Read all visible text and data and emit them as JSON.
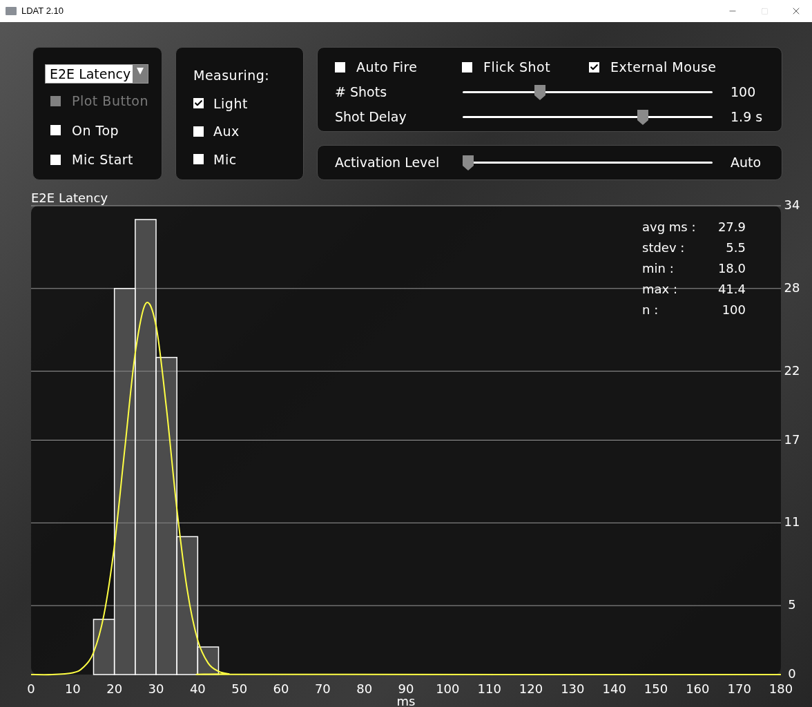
{
  "window": {
    "title": "LDAT 2.10",
    "maximize_disabled": true
  },
  "mode_panel": {
    "dropdown": {
      "value": "E2E Latency"
    },
    "options": [
      {
        "label": "Plot Button",
        "checked": false,
        "disabled": true
      },
      {
        "label": "On Top",
        "checked": false,
        "disabled": false
      },
      {
        "label": "Mic Start",
        "checked": false,
        "disabled": false
      }
    ]
  },
  "measuring_panel": {
    "title": "Measuring:",
    "options": [
      {
        "label": "Light",
        "checked": true
      },
      {
        "label": "Aux",
        "checked": false
      },
      {
        "label": "Mic",
        "checked": false
      }
    ]
  },
  "shot_panel": {
    "options": [
      {
        "label": "Auto Fire",
        "checked": false
      },
      {
        "label": "Flick Shot",
        "checked": false
      },
      {
        "label": "External Mouse",
        "checked": true
      }
    ],
    "sliders": [
      {
        "label": "# Shots",
        "level": 0.3,
        "reading": "100"
      },
      {
        "label": "Shot Delay",
        "level": 0.73,
        "reading": "1.9 s"
      }
    ]
  },
  "activation_panel": {
    "label": "Activation Level",
    "level": 0,
    "reading": "Auto"
  },
  "chart": {
    "title": "E2E Latency",
    "stats": [
      {
        "label": "avg ms :",
        "value": "27.9"
      },
      {
        "label": "stdev :",
        "value": "5.5"
      },
      {
        "label": "min :",
        "value": "18.0"
      },
      {
        "label": "max :",
        "value": "41.4"
      },
      {
        "label": "n :",
        "value": "100"
      }
    ],
    "chart_data": {
      "type": "bar",
      "xlabel": "ms",
      "xlim": [
        0,
        180
      ],
      "ylim": [
        0,
        34
      ],
      "xticks": [
        0,
        10,
        20,
        30,
        40,
        50,
        60,
        70,
        80,
        90,
        100,
        110,
        120,
        130,
        140,
        150,
        160,
        170,
        180
      ],
      "yticks": [
        0,
        5,
        11,
        17,
        22,
        28,
        34
      ],
      "grid": true,
      "x": [
        0,
        5,
        10,
        12.5,
        15,
        17.5,
        20,
        22.5,
        25,
        27.5,
        30,
        32.5,
        35,
        37.5,
        40,
        42.5,
        45,
        47.5,
        50,
        180
      ],
      "series": [
        {
          "type": "bar",
          "color": "#ffffff",
          "values": [
            null,
            null,
            null,
            null,
            null,
            4,
            null,
            28,
            null,
            33,
            null,
            23,
            null,
            10,
            null,
            2,
            null,
            null,
            null,
            null
          ]
        },
        {
          "type": "line",
          "color": "#ffff44",
          "values": [
            0,
            0,
            0.13,
            0.51,
            1.6,
            4.35,
            9.35,
            16.4,
            23.3,
            26.9,
            25.3,
            19.3,
            12.0,
            6.1,
            2.5,
            0.83,
            0.23,
            0.05,
            0.01,
            0
          ]
        }
      ]
    }
  }
}
